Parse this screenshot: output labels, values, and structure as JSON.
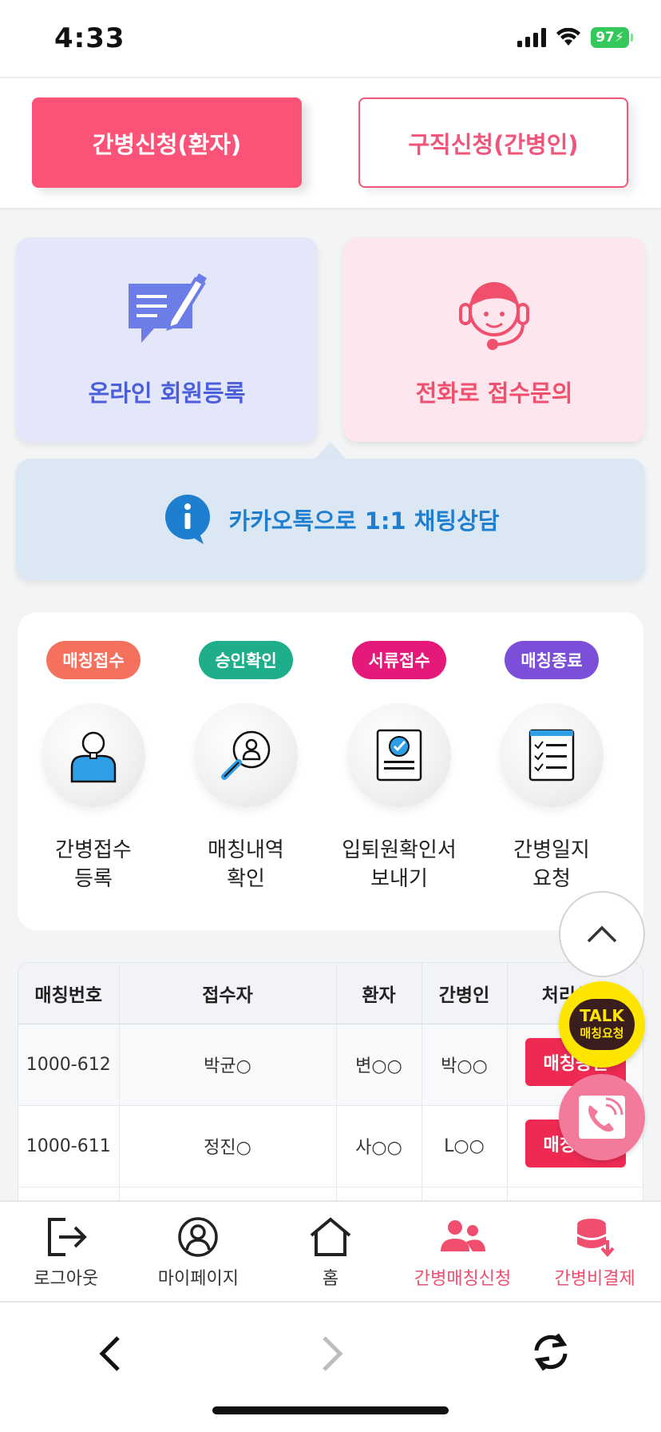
{
  "status_bar": {
    "time": "4:33",
    "battery": "97"
  },
  "top_buttons": {
    "patient_apply": "간병신청(환자)",
    "caregiver_apply": "구직신청(간병인)"
  },
  "cards": {
    "online_register": "온라인 회원등록",
    "phone_inquiry": "전화로 접수문의"
  },
  "kakao_chat": {
    "label": "카카오톡으로 1:1 채팅상담"
  },
  "process": {
    "steps": [
      {
        "badge": "매칭접수",
        "badge_color": "#f4715e",
        "label": "간병접수\n등록",
        "icon": "person-icon"
      },
      {
        "badge": "승인확인",
        "badge_color": "#1fae8c",
        "label": "매칭내역\n확인",
        "icon": "search-person-icon"
      },
      {
        "badge": "서류접수",
        "badge_color": "#e5197a",
        "label": "입퇴원확인서\n보내기",
        "icon": "document-check-icon"
      },
      {
        "badge": "매칭종료",
        "badge_color": "#7c4fd8",
        "label": "간병일지\n요청",
        "icon": "checklist-icon"
      }
    ]
  },
  "table": {
    "headers": [
      "매칭번호",
      "접수자",
      "환자",
      "간병인",
      "처리상태"
    ],
    "rows": [
      [
        "1000-612",
        "박균○",
        "변○○",
        "박○○",
        "매칭승인"
      ],
      [
        "1000-611",
        "정진○",
        "사○○",
        "L○○",
        "매칭승인"
      ]
    ]
  },
  "floating": {
    "talk_big": "TALK",
    "talk_small": "매칭요청"
  },
  "bottom_nav": [
    {
      "label": "로그아웃",
      "icon": "logout-icon"
    },
    {
      "label": "마이페이지",
      "icon": "user-circle-icon"
    },
    {
      "label": "홈",
      "icon": "home-icon"
    },
    {
      "label": "간병매칭신청",
      "icon": "users-icon",
      "active": true
    },
    {
      "label": "간병비결제",
      "icon": "payment-icon",
      "active": true
    }
  ],
  "colors": {
    "primary": "#fb5377",
    "accent_blue": "#1e7fd1",
    "indigo": "#4c5fdb"
  }
}
